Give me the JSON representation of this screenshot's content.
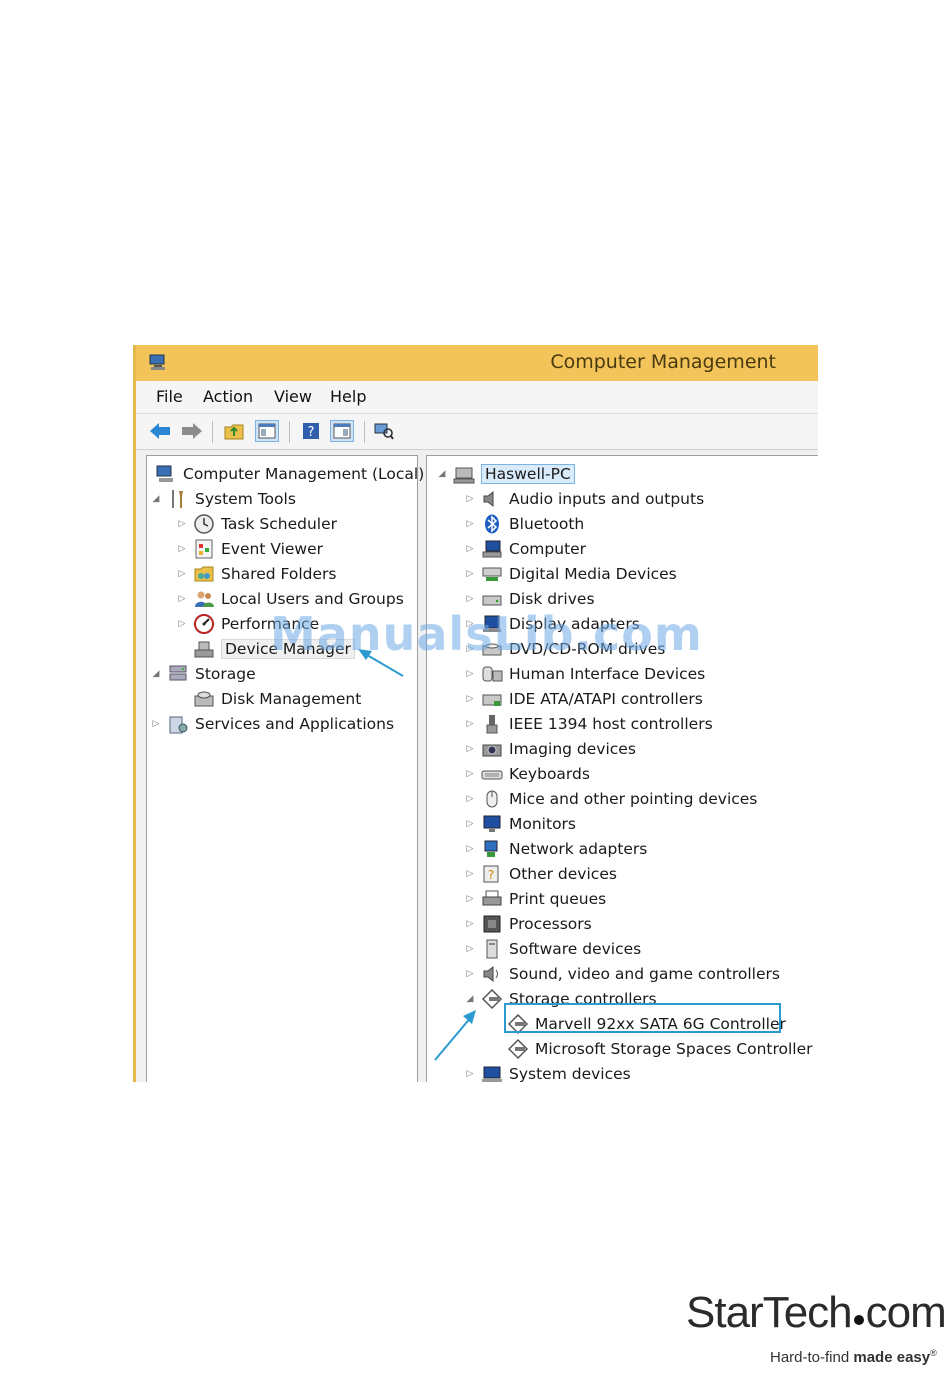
{
  "window": {
    "title": "Computer Management"
  },
  "menu": [
    "File",
    "Action",
    "View",
    "Help"
  ],
  "left_tree": [
    {
      "label": "Computer Management (Local)",
      "icon": "computer-management-icon",
      "level": 0,
      "expander": ""
    },
    {
      "label": "System Tools",
      "icon": "tools-icon",
      "level": 1,
      "expander": "expanded"
    },
    {
      "label": "Task Scheduler",
      "icon": "clock-icon",
      "level": 2,
      "expander": "collapsed"
    },
    {
      "label": "Event Viewer",
      "icon": "event-viewer-icon",
      "level": 2,
      "expander": "collapsed"
    },
    {
      "label": "Shared Folders",
      "icon": "shared-folder-icon",
      "level": 2,
      "expander": "collapsed"
    },
    {
      "label": "Local Users and Groups",
      "icon": "users-icon",
      "level": 2,
      "expander": "collapsed"
    },
    {
      "label": "Performance",
      "icon": "performance-icon",
      "level": 2,
      "expander": "collapsed"
    },
    {
      "label": "Device Manager",
      "icon": "device-manager-icon",
      "level": 2,
      "expander": ""
    },
    {
      "label": "Storage",
      "icon": "storage-icon",
      "level": 1,
      "expander": "expanded"
    },
    {
      "label": "Disk Management",
      "icon": "disk-management-icon",
      "level": 2,
      "expander": ""
    },
    {
      "label": "Services and Applications",
      "icon": "services-icon",
      "level": 1,
      "expander": "collapsed"
    }
  ],
  "right_tree": {
    "root": "Haswell-PC",
    "items": [
      {
        "label": "Audio inputs and outputs",
        "icon": "speaker-icon",
        "level": 1,
        "expander": "collapsed"
      },
      {
        "label": "Bluetooth",
        "icon": "bluetooth-icon",
        "level": 1,
        "expander": "collapsed"
      },
      {
        "label": "Computer",
        "icon": "computer-icon",
        "level": 1,
        "expander": "collapsed"
      },
      {
        "label": "Digital Media Devices",
        "icon": "media-device-icon",
        "level": 1,
        "expander": "collapsed"
      },
      {
        "label": "Disk drives",
        "icon": "disk-drive-icon",
        "level": 1,
        "expander": "collapsed"
      },
      {
        "label": "Display adapters",
        "icon": "display-adapter-icon",
        "level": 1,
        "expander": "collapsed"
      },
      {
        "label": "DVD/CD-ROM drives",
        "icon": "dvd-drive-icon",
        "level": 1,
        "expander": "collapsed"
      },
      {
        "label": "Human Interface Devices",
        "icon": "hid-icon",
        "level": 1,
        "expander": "collapsed"
      },
      {
        "label": "IDE ATA/ATAPI controllers",
        "icon": "ide-controller-icon",
        "level": 1,
        "expander": "collapsed"
      },
      {
        "label": "IEEE 1394 host controllers",
        "icon": "ieee1394-icon",
        "level": 1,
        "expander": "collapsed"
      },
      {
        "label": "Imaging devices",
        "icon": "camera-icon",
        "level": 1,
        "expander": "collapsed"
      },
      {
        "label": "Keyboards",
        "icon": "keyboard-icon",
        "level": 1,
        "expander": "collapsed"
      },
      {
        "label": "Mice and other pointing devices",
        "icon": "mouse-icon",
        "level": 1,
        "expander": "collapsed"
      },
      {
        "label": "Monitors",
        "icon": "monitor-icon",
        "level": 1,
        "expander": "collapsed"
      },
      {
        "label": "Network adapters",
        "icon": "network-icon",
        "level": 1,
        "expander": "collapsed"
      },
      {
        "label": "Other devices",
        "icon": "unknown-device-icon",
        "level": 1,
        "expander": "collapsed"
      },
      {
        "label": "Print queues",
        "icon": "printer-icon",
        "level": 1,
        "expander": "collapsed"
      },
      {
        "label": "Processors",
        "icon": "processor-icon",
        "level": 1,
        "expander": "collapsed"
      },
      {
        "label": "Software devices",
        "icon": "software-device-icon",
        "level": 1,
        "expander": "collapsed"
      },
      {
        "label": "Sound, video and game controllers",
        "icon": "sound-icon",
        "level": 1,
        "expander": "collapsed"
      },
      {
        "label": "Storage controllers",
        "icon": "storage-controller-icon",
        "level": 1,
        "expander": "expanded"
      },
      {
        "label": "Marvell 92xx SATA 6G Controller",
        "icon": "storage-controller-icon",
        "level": 2,
        "expander": "",
        "highlighted": true
      },
      {
        "label": "Microsoft Storage Spaces Controller",
        "icon": "storage-controller-icon",
        "level": 2,
        "expander": ""
      },
      {
        "label": "System devices",
        "icon": "system-device-icon",
        "level": 1,
        "expander": "collapsed"
      }
    ]
  },
  "watermark": "ManualsLib.com",
  "logo": {
    "brand_a": "StarTech",
    "brand_b": "com",
    "tagline_a": "Hard-to-find ",
    "tagline_b": "made easy",
    "trademark": "®"
  },
  "colors": {
    "titlebar": "#f3c45a",
    "accent": "#2a9bd0",
    "selection": "#d9ebfa"
  }
}
